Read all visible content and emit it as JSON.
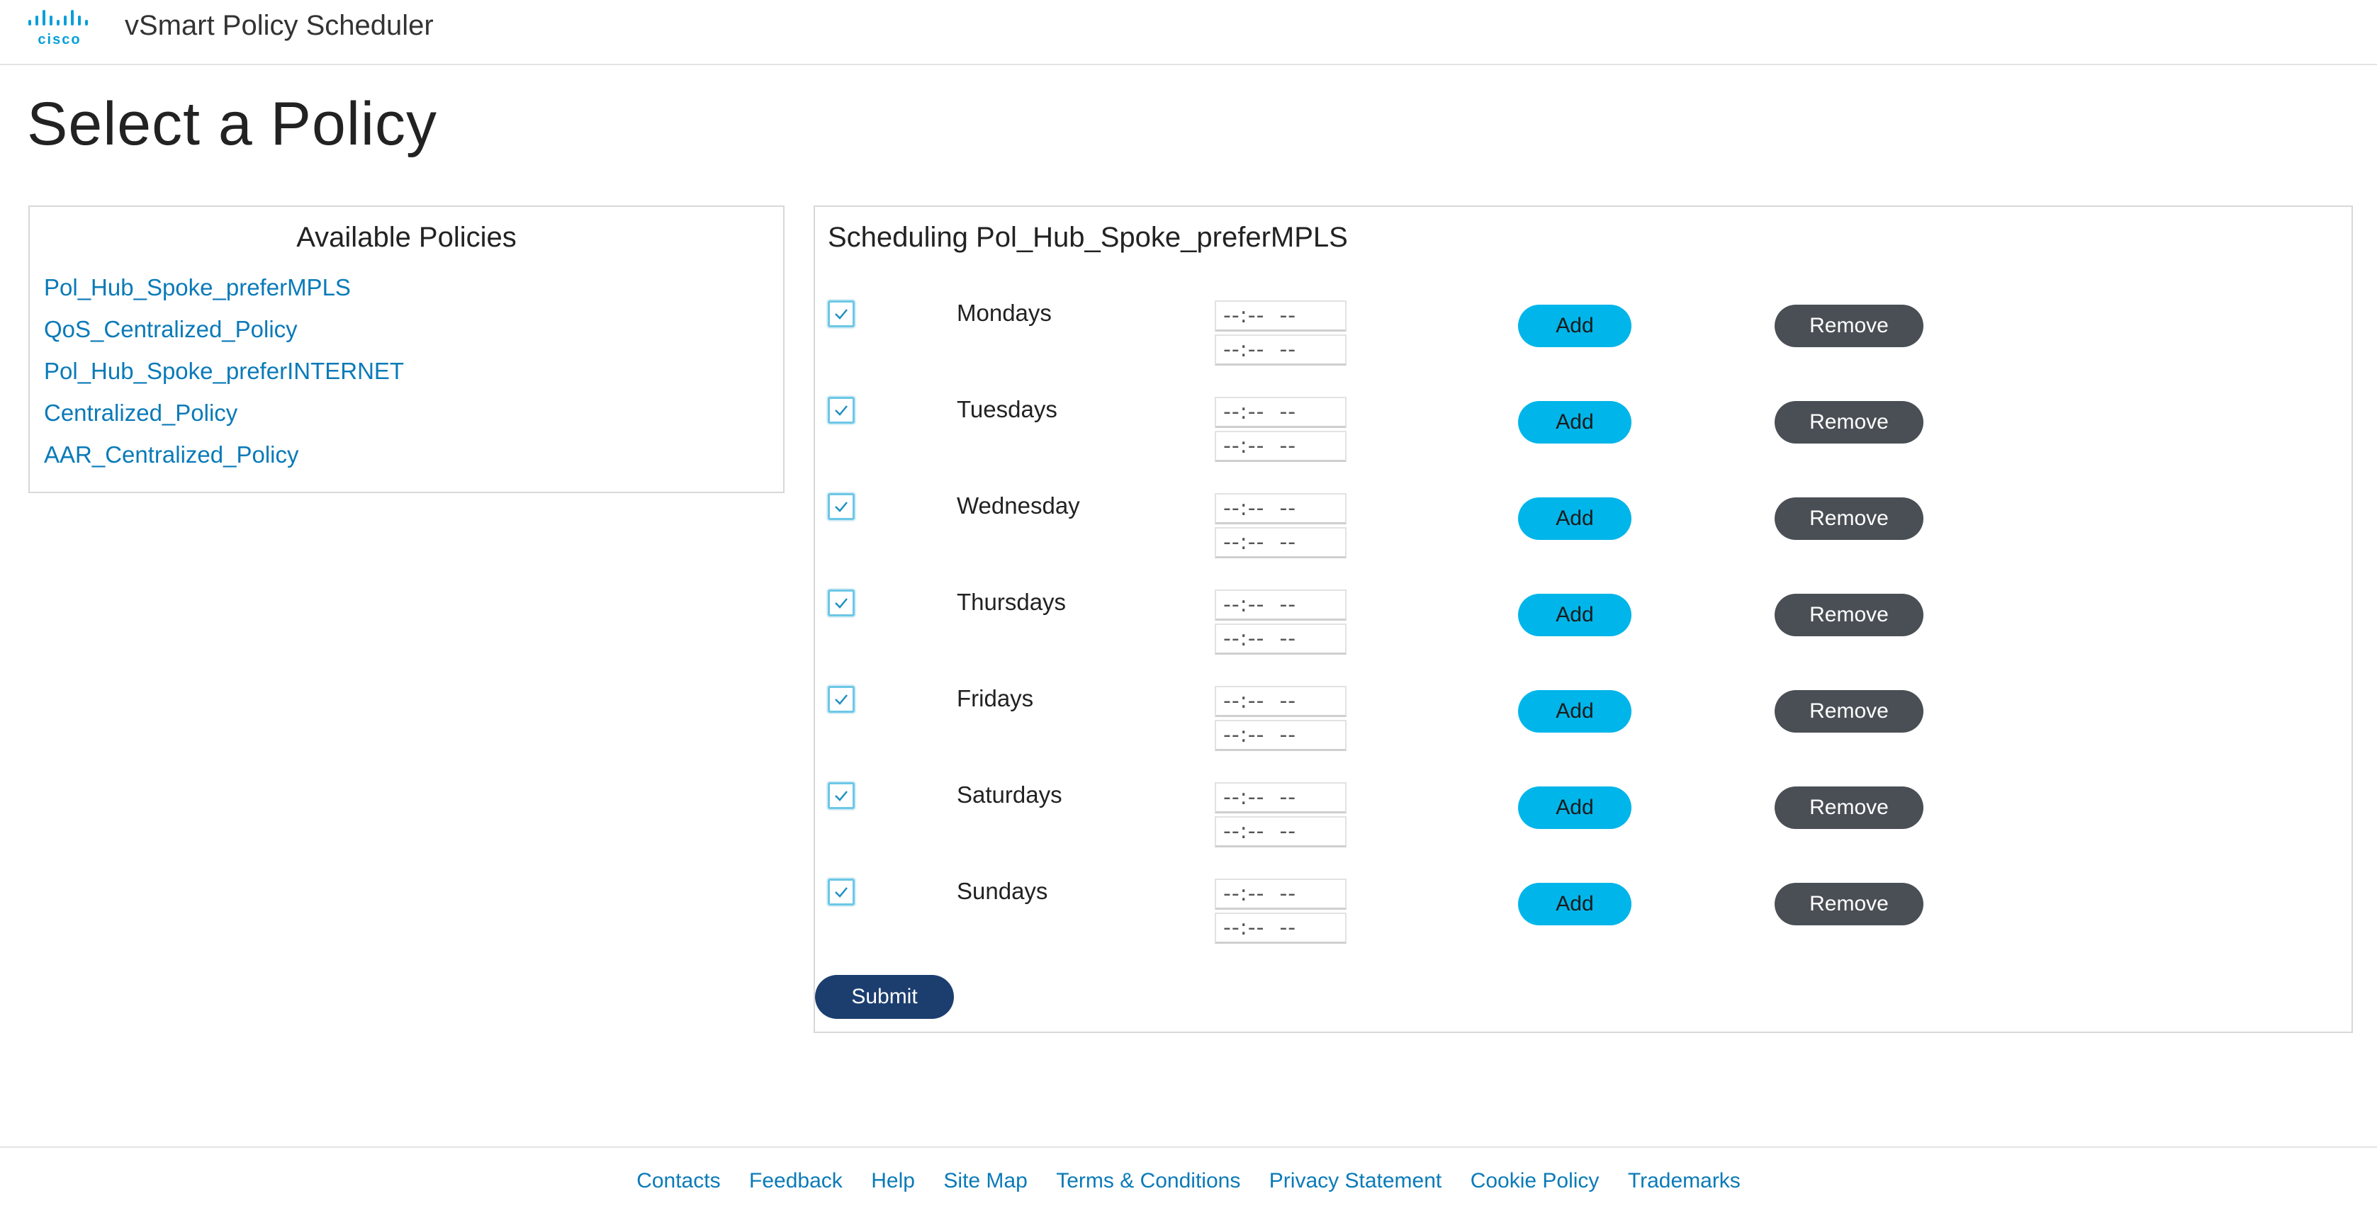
{
  "header": {
    "logo_text": "cisco",
    "app_title": "vSmart Policy Scheduler"
  },
  "page_title": "Select a Policy",
  "left_panel": {
    "title": "Available Policies",
    "policies": [
      "Pol_Hub_Spoke_preferMPLS",
      "QoS_Centralized_Policy",
      "Pol_Hub_Spoke_preferINTERNET",
      "Centralized_Policy",
      "AAR_Centralized_Policy"
    ]
  },
  "schedule": {
    "title": "Scheduling Pol_Hub_Spoke_preferMPLS",
    "days": [
      {
        "label": "Mondays",
        "checked": true,
        "start": "--:--  --",
        "end": "--:--  --",
        "add_label": "Add",
        "remove_label": "Remove"
      },
      {
        "label": "Tuesdays",
        "checked": true,
        "start": "--:--  --",
        "end": "--:--  --",
        "add_label": "Add",
        "remove_label": "Remove"
      },
      {
        "label": "Wednesday",
        "checked": true,
        "start": "--:--  --",
        "end": "--:--  --",
        "add_label": "Add",
        "remove_label": "Remove"
      },
      {
        "label": "Thursdays",
        "checked": true,
        "start": "--:--  --",
        "end": "--:--  --",
        "add_label": "Add",
        "remove_label": "Remove"
      },
      {
        "label": "Fridays",
        "checked": true,
        "start": "--:--  --",
        "end": "--:--  --",
        "add_label": "Add",
        "remove_label": "Remove"
      },
      {
        "label": "Saturdays",
        "checked": true,
        "start": "--:--  --",
        "end": "--:--  --",
        "add_label": "Add",
        "remove_label": "Remove"
      },
      {
        "label": "Sundays",
        "checked": true,
        "start": "--:--  --",
        "end": "--:--  --",
        "add_label": "Add",
        "remove_label": "Remove"
      }
    ],
    "submit_label": "Submit"
  },
  "footer": {
    "links": [
      "Contacts",
      "Feedback",
      "Help",
      "Site Map",
      "Terms & Conditions",
      "Privacy Statement",
      "Cookie Policy",
      "Trademarks"
    ]
  },
  "colors": {
    "link": "#0a7ab8",
    "add_button": "#00b5e9",
    "remove_button": "#4a4f55",
    "submit_button": "#1c3e6f",
    "checkbox_border": "#6cc7e6"
  }
}
